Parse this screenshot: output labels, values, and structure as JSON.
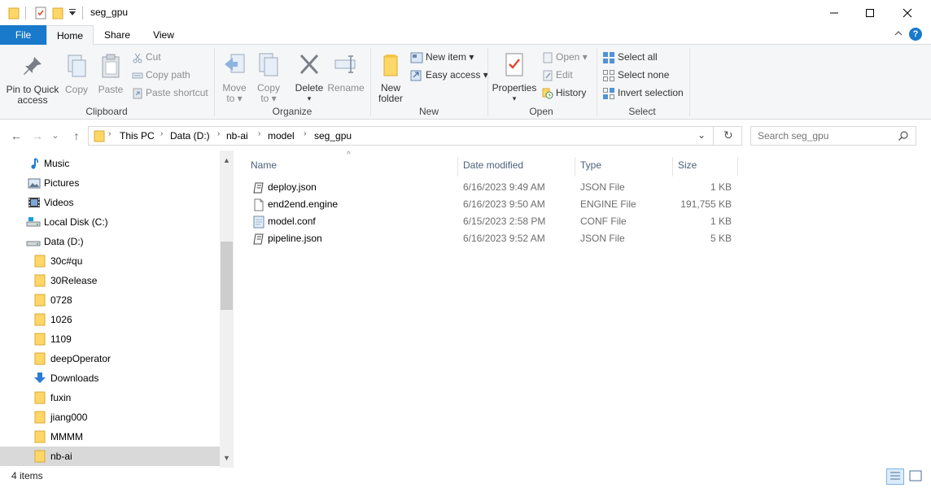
{
  "window": {
    "title": "seg_gpu",
    "minimize_glyph": "—",
    "maximize_glyph": "☐",
    "close_glyph": "✕"
  },
  "tabs": {
    "file": "File",
    "home": "Home",
    "share": "Share",
    "view": "View",
    "collapse_glyph": "^",
    "help_glyph": "?"
  },
  "ribbon": {
    "clipboard": {
      "label": "Clipboard",
      "pin": "Pin to Quick access",
      "pin_line1": "Pin to Quick",
      "pin_line2": "access",
      "copy": "Copy",
      "paste": "Paste",
      "cut": "Cut",
      "copy_path": "Copy path",
      "paste_shortcut": "Paste shortcut"
    },
    "organize": {
      "label": "Organize",
      "move_line1": "Move",
      "move_line2": "to ▾",
      "copy_line1": "Copy",
      "copy_line2": "to ▾",
      "delete": "Delete",
      "delete_arrow": "▾",
      "rename": "Rename"
    },
    "new": {
      "label": "New",
      "new_folder_line1": "New",
      "new_folder_line2": "folder",
      "new_item": "New item ▾",
      "easy_access": "Easy access ▾"
    },
    "open": {
      "label": "Open",
      "properties": "Properties",
      "properties_arrow": "▾",
      "open": "Open ▾",
      "edit": "Edit",
      "history": "History"
    },
    "select": {
      "label": "Select",
      "select_all": "Select all",
      "select_none": "Select none",
      "invert_selection": "Invert selection"
    }
  },
  "address": {
    "back": "←",
    "forward": "→",
    "recent": "⌄",
    "up": "↑",
    "crumbs": [
      "This PC",
      "Data (D:)",
      "nb-ai",
      "model",
      "seg_gpu"
    ],
    "separator": "›",
    "dropdown": "⌄",
    "refresh": "↻",
    "search_placeholder": "Search seg_gpu"
  },
  "nav": {
    "items": [
      {
        "label": "Music",
        "icon": "music-icon"
      },
      {
        "label": "Pictures",
        "icon": "pictures-icon"
      },
      {
        "label": "Videos",
        "icon": "videos-icon"
      },
      {
        "label": "Local Disk (C:)",
        "icon": "drive-icon"
      },
      {
        "label": "Data (D:)",
        "icon": "drive-icon"
      },
      {
        "label": "30c#qu",
        "icon": "folder-icon"
      },
      {
        "label": "30Release",
        "icon": "folder-icon"
      },
      {
        "label": "0728",
        "icon": "folder-icon"
      },
      {
        "label": "1026",
        "icon": "folder-icon"
      },
      {
        "label": "1109",
        "icon": "folder-icon"
      },
      {
        "label": "deepOperator",
        "icon": "folder-icon"
      },
      {
        "label": "Downloads",
        "icon": "downloads-icon"
      },
      {
        "label": "fuxin",
        "icon": "folder-icon"
      },
      {
        "label": "jiang000",
        "icon": "folder-icon"
      },
      {
        "label": "MMMM",
        "icon": "folder-icon"
      },
      {
        "label": "nb-ai",
        "icon": "folder-icon"
      }
    ],
    "scroll_up": "▲",
    "scroll_down": "▼"
  },
  "files": {
    "columns": {
      "name": "Name",
      "date": "Date modified",
      "type": "Type",
      "size": "Size"
    },
    "sort_glyph": "^",
    "rows": [
      {
        "name": "deploy.json",
        "date": "6/16/2023 9:49 AM",
        "type": "JSON File",
        "size": "1 KB",
        "icon": "json-file-icon"
      },
      {
        "name": "end2end.engine",
        "date": "6/16/2023 9:50 AM",
        "type": "ENGINE File",
        "size": "191,755 KB",
        "icon": "blank-file-icon"
      },
      {
        "name": "model.conf",
        "date": "6/15/2023 2:58 PM",
        "type": "CONF File",
        "size": "1 KB",
        "icon": "conf-file-icon"
      },
      {
        "name": "pipeline.json",
        "date": "6/16/2023 9:52 AM",
        "type": "JSON File",
        "size": "5 KB",
        "icon": "json-file-icon"
      }
    ]
  },
  "status": {
    "item_count": "4 items"
  },
  "colors": {
    "file_tab": "#1979ca",
    "folder": "#ffd766",
    "header_text": "#4c607a",
    "selected_nav": "#d9d9d9"
  }
}
